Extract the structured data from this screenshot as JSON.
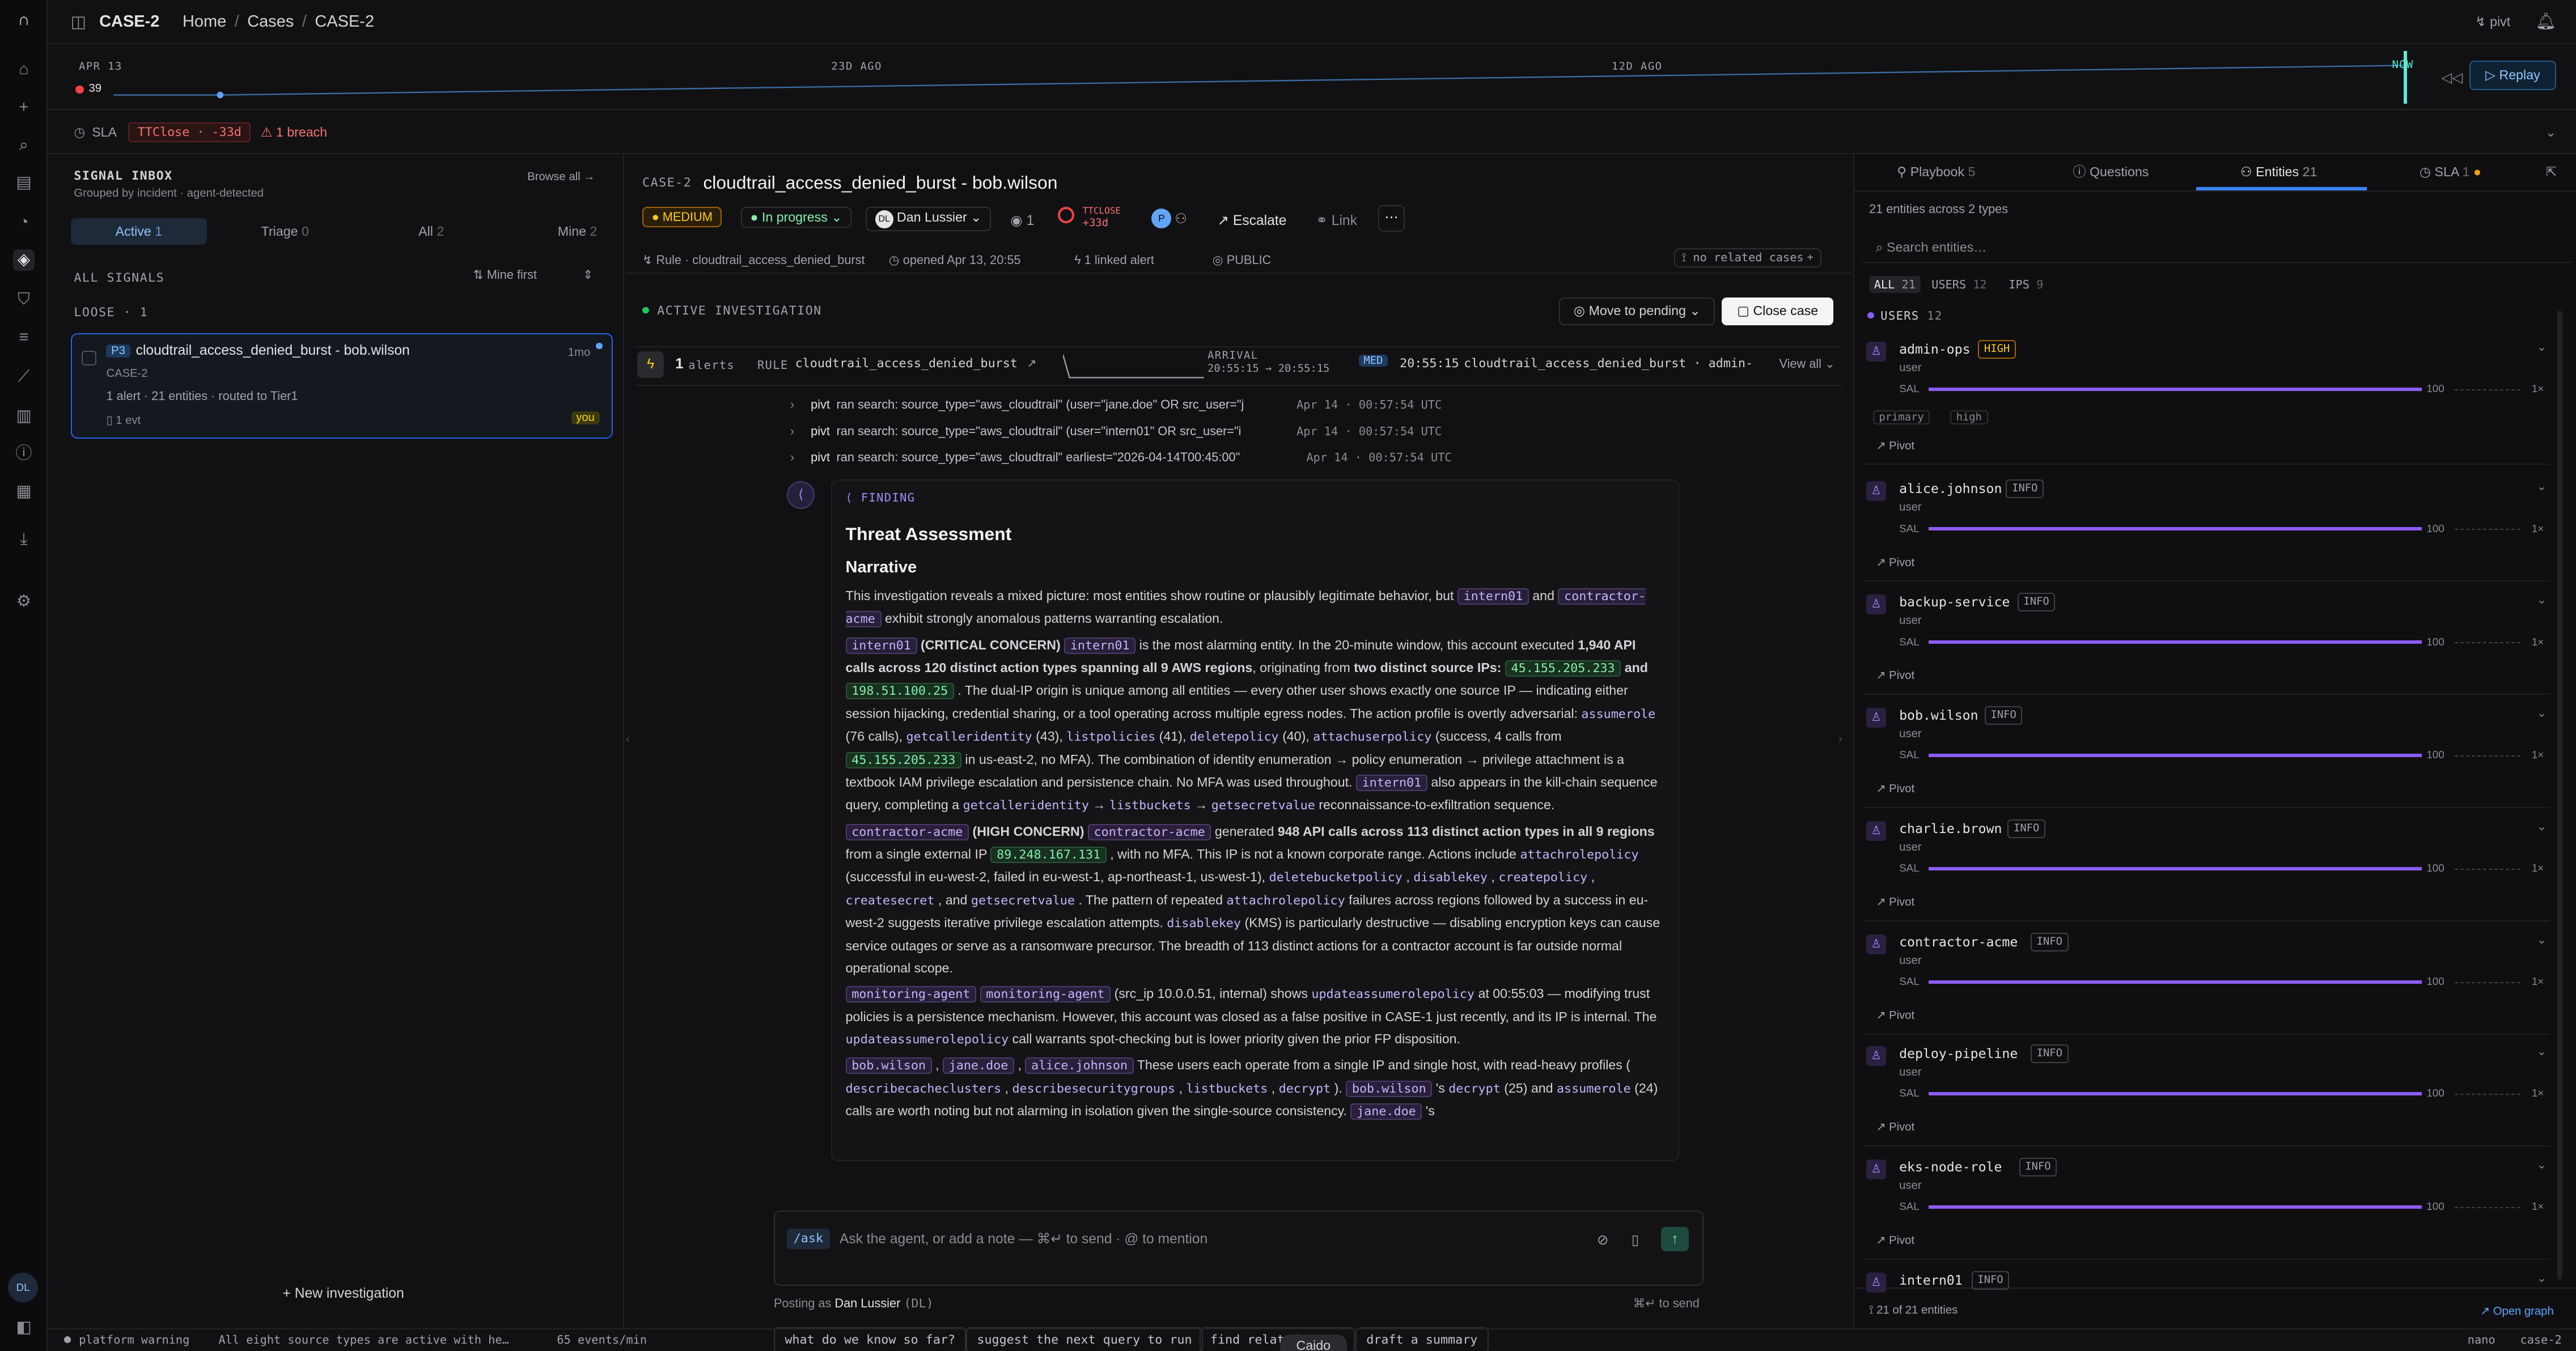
{
  "header": {
    "case": "CASE-2",
    "crumbs": [
      "Home",
      "Cases",
      "CASE-2"
    ],
    "user": "pivt"
  },
  "timeline": {
    "start": "APR 13",
    "count": "39",
    "mark1": "23D AGO",
    "mark2": "12D AGO",
    "now": "NOW",
    "replay": "Replay"
  },
  "sla": {
    "label": "SLA",
    "pill": "TTClose · -33d",
    "breach": "1 breach"
  },
  "inbox": {
    "title": "SIGNAL INBOX",
    "subtitle": "Grouped by incident · agent-detected",
    "browse": "Browse all →",
    "tabs": [
      {
        "label": "Active",
        "count": "1"
      },
      {
        "label": "Triage",
        "count": "0"
      },
      {
        "label": "All",
        "count": "2"
      },
      {
        "label": "Mine",
        "count": "2"
      }
    ],
    "all_signals": "ALL SIGNALS",
    "sort": "Mine first",
    "loose": "LOOSE · 1",
    "new": "New investigation"
  },
  "signal": {
    "priority": "P3",
    "title": "cloudtrail_access_denied_burst - bob.wilson",
    "age": "1mo",
    "case": "CASE-2",
    "meta": "1 alert · 21 entities · routed to Tier1",
    "evt": "1 evt",
    "you": "you"
  },
  "case": {
    "id": "CASE-2",
    "title": "cloudtrail_access_denied_burst - bob.wilson",
    "severity": "MEDIUM",
    "status": "In progress",
    "assignee": "Dan Lussier",
    "assignee_initials": "DL",
    "views": "1",
    "ttl_label": "TTCLOSE",
    "ttl_value": "+33d",
    "escalate": "Escalate",
    "link": "Link",
    "rule": "Rule · cloudtrail_access_denied_burst",
    "opened": "opened Apr 13, 20:55",
    "linked": "1 linked alert",
    "visibility": "PUBLIC",
    "related": "no related cases"
  },
  "investigation": {
    "label": "ACTIVE INVESTIGATION",
    "move": "Move to pending",
    "close": "Close case",
    "alerts_n": "1",
    "alerts": "alerts",
    "rule_label": "RULE",
    "rule": "cloudtrail_access_denied_burst",
    "arrival": "ARRIVAL",
    "arrival_range": "20:55:15 → 20:55:15",
    "med": "MED",
    "alert_time": "20:55:15",
    "alert_text": "cloudtrail_access_denied_burst · admin-…",
    "view_all": "View all"
  },
  "log": [
    {
      "who": "pivt",
      "text": "ran search: source_type=\"aws_cloudtrail\" (user=\"jane.doe\" OR src_user=\"j",
      "ts": "Apr 14 · 00:57:54 UTC"
    },
    {
      "who": "pivt",
      "text": "ran search: source_type=\"aws_cloudtrail\" (user=\"intern01\" OR src_user=\"i",
      "ts": "Apr 14 · 00:57:54 UTC"
    },
    {
      "who": "pivt",
      "text": "ran search: source_type=\"aws_cloudtrail\" earliest=\"2026-04-14T00:45:00\"",
      "ts": "Apr 14 · 00:57:54 UTC"
    }
  ],
  "finding": {
    "label": "FINDING",
    "h1": "Threat Assessment",
    "h2": "Narrative"
  },
  "suggestions": [
    "what do we know so far?",
    "suggest the next query to run",
    "find related cases",
    "draft a summary"
  ],
  "composer": {
    "ask": "/ask",
    "placeholder": "Ask the agent, or add a note — ⌘↵ to send · @ to mention",
    "posting": "Posting as",
    "posting_user": "Dan Lussier",
    "posting_initials": "(DL)",
    "send_hint": "⌘↵ to send"
  },
  "right": {
    "tabs": [
      {
        "label": "Playbook",
        "count": "5"
      },
      {
        "label": "Questions",
        "count": ""
      },
      {
        "label": "Entities",
        "count": "21"
      },
      {
        "label": "SLA",
        "count": "1"
      }
    ],
    "summary": "21 entities across 2 types",
    "search": "Search entities…",
    "filters": [
      {
        "label": "ALL",
        "count": "21"
      },
      {
        "label": "USERS",
        "count": "12"
      },
      {
        "label": "IPS",
        "count": "9"
      }
    ],
    "group": "USERS",
    "group_count": "12",
    "footer": "21 of 21 entities",
    "open_graph": "Open graph"
  },
  "entities": [
    {
      "name": "admin-ops",
      "sev": "HIGH",
      "type": "user",
      "sal": "SAL",
      "val": "100",
      "ox": "1×",
      "tags": [
        "primary",
        "high"
      ],
      "pivot": "Pivot"
    },
    {
      "name": "alice.johnson",
      "sev": "INFO",
      "type": "user",
      "sal": "SAL",
      "val": "100",
      "ox": "1×",
      "pivot": "Pivot"
    },
    {
      "name": "backup-service",
      "sev": "INFO",
      "type": "user",
      "sal": "SAL",
      "val": "100",
      "ox": "1×",
      "pivot": "Pivot"
    },
    {
      "name": "bob.wilson",
      "sev": "INFO",
      "type": "user",
      "sal": "SAL",
      "val": "100",
      "ox": "1×",
      "pivot": "Pivot"
    },
    {
      "name": "charlie.brown",
      "sev": "INFO",
      "type": "user",
      "sal": "SAL",
      "val": "100",
      "ox": "1×",
      "pivot": "Pivot"
    },
    {
      "name": "contractor-acme",
      "sev": "INFO",
      "type": "user",
      "sal": "SAL",
      "val": "100",
      "ox": "1×",
      "pivot": "Pivot"
    },
    {
      "name": "deploy-pipeline",
      "sev": "INFO",
      "type": "user",
      "sal": "SAL",
      "val": "100",
      "ox": "1×",
      "pivot": "Pivot"
    },
    {
      "name": "eks-node-role",
      "sev": "INFO",
      "type": "user",
      "sal": "SAL",
      "val": "100",
      "ox": "1×",
      "pivot": "Pivot"
    },
    {
      "name": "intern01",
      "sev": "INFO"
    }
  ],
  "statusbar": {
    "warning": "platform warning",
    "message": "All eight source types are active with he…",
    "rate": "65 events/min",
    "center": "Caido",
    "right1": "nano",
    "right2": "case-2"
  },
  "user_initials": "DL"
}
